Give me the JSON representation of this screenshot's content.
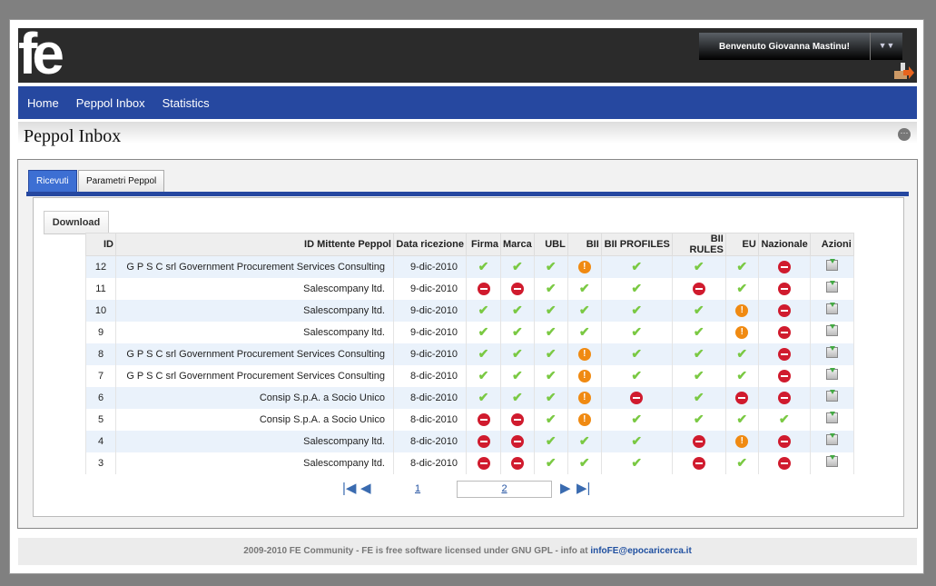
{
  "header": {
    "logo": "fe",
    "welcome": "Benvenuto Giovanna Mastinu!",
    "menu_icon": "chevron-down-icon",
    "logout_icon": "logout-icon"
  },
  "nav": [
    {
      "label": "Home"
    },
    {
      "label": "Peppol Inbox"
    },
    {
      "label": "Statistics"
    }
  ],
  "page": {
    "title": "Peppol Inbox"
  },
  "tabs": [
    {
      "label": "Ricevuti",
      "active": true
    },
    {
      "label": "Parametri Peppol",
      "active": false
    }
  ],
  "toolbar": {
    "download_label": "Download"
  },
  "table": {
    "columns": [
      "ID",
      "ID Mittente Peppol",
      "Data ricezione",
      "Firma",
      "Marca",
      "UBL",
      "BII",
      "BII PROFILES",
      "BII RULES",
      "EU",
      "Nazionale",
      "Azioni"
    ],
    "rows": [
      {
        "id": "12",
        "sender": "G P S C srl Government Procurement Services Consulting",
        "date": "9-dic-2010",
        "s": [
          "ok",
          "ok",
          "ok",
          "warn",
          "ok",
          "ok",
          "ok",
          "err"
        ]
      },
      {
        "id": "11",
        "sender": "Salescompany ltd.",
        "date": "9-dic-2010",
        "s": [
          "err",
          "err",
          "ok",
          "ok",
          "ok",
          "err",
          "ok",
          "err"
        ]
      },
      {
        "id": "10",
        "sender": "Salescompany ltd.",
        "date": "9-dic-2010",
        "s": [
          "ok",
          "ok",
          "ok",
          "ok",
          "ok",
          "ok",
          "warn",
          "err"
        ]
      },
      {
        "id": "9",
        "sender": "Salescompany ltd.",
        "date": "9-dic-2010",
        "s": [
          "ok",
          "ok",
          "ok",
          "ok",
          "ok",
          "ok",
          "warn",
          "err"
        ]
      },
      {
        "id": "8",
        "sender": "G P S C srl Government Procurement Services Consulting",
        "date": "9-dic-2010",
        "s": [
          "ok",
          "ok",
          "ok",
          "warn",
          "ok",
          "ok",
          "ok",
          "err"
        ]
      },
      {
        "id": "7",
        "sender": "G P S C srl Government Procurement Services Consulting",
        "date": "8-dic-2010",
        "s": [
          "ok",
          "ok",
          "ok",
          "warn",
          "ok",
          "ok",
          "ok",
          "err"
        ]
      },
      {
        "id": "6",
        "sender": "Consip S.p.A. a Socio Unico",
        "date": "8-dic-2010",
        "s": [
          "ok",
          "ok",
          "ok",
          "warn",
          "err",
          "ok",
          "err",
          "err"
        ]
      },
      {
        "id": "5",
        "sender": "Consip S.p.A. a Socio Unico",
        "date": "8-dic-2010",
        "s": [
          "err",
          "err",
          "ok",
          "warn",
          "ok",
          "ok",
          "ok",
          "ok"
        ]
      },
      {
        "id": "4",
        "sender": "Salescompany ltd.",
        "date": "8-dic-2010",
        "s": [
          "err",
          "err",
          "ok",
          "ok",
          "ok",
          "err",
          "warn",
          "err"
        ]
      },
      {
        "id": "3",
        "sender": "Salescompany ltd.",
        "date": "8-dic-2010",
        "s": [
          "err",
          "err",
          "ok",
          "ok",
          "ok",
          "err",
          "ok",
          "err"
        ]
      }
    ]
  },
  "pager": {
    "pages": [
      "1",
      "2"
    ],
    "current": "2"
  },
  "footer": {
    "text": "2009-2010 FE Community - FE is free software licensed under GNU GPL - info at ",
    "email": "infoFE@epocaricerca.it"
  },
  "colors": {
    "nav": "#2648a0",
    "ok": "#7ac943",
    "err": "#d01b2e",
    "warn": "#f08a12"
  }
}
